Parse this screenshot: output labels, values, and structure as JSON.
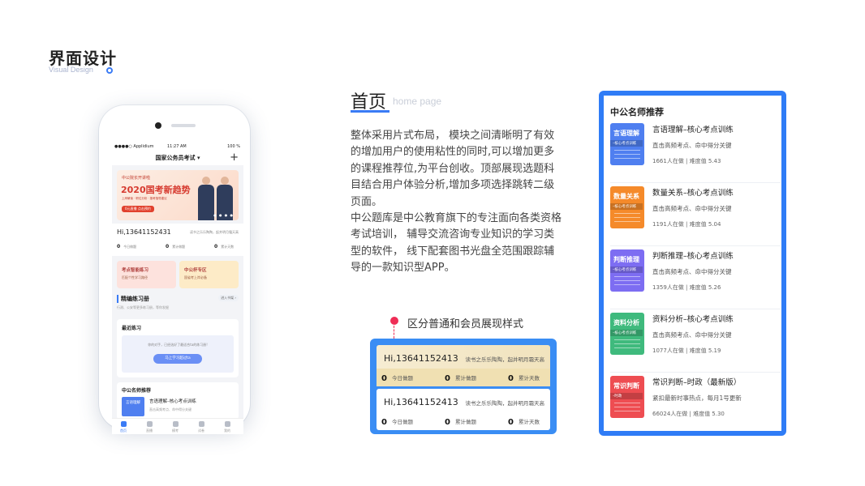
{
  "heading": {
    "title": "界面设计",
    "subtitle": "Visual Design"
  },
  "phone": {
    "status": {
      "carrier": "●●●●○ Applidium",
      "time": "11:27 AM",
      "battery": "100 %"
    },
    "nav_title": "国家公务员考试 ▾",
    "plus": "+",
    "banner": {
      "tag": "中公院长开讲啦",
      "main": "2020国考新趋势",
      "chips": "上岸解读 · 职位分析 · 报考指导建议",
      "button": "0元直播  点击预约"
    },
    "user": {
      "name": "Hi,13641152431",
      "note": "读书之乐乐陶陶，起并明月霜天高",
      "stats": [
        {
          "value": "0",
          "label": "今日做题"
        },
        {
          "value": "0",
          "label": "累计做题"
        },
        {
          "value": "0",
          "label": "累计天数"
        }
      ]
    },
    "cards": [
      {
        "title": "考点智能练习",
        "desc": "匹配个性学习路径",
        "color": "#fde2dd"
      },
      {
        "title": "中公杯专区",
        "desc": "国省考上岸必备",
        "color": "#fdebc7"
      }
    ],
    "section": {
      "title": "精编练习册",
      "desc": "行测、公安等更多练习册，等你发掘",
      "more": "进入书架 ›"
    },
    "recent": {
      "title": "最近练习",
      "desc": "你的对手，已经选好了最适合ta的练习册!",
      "button": "马上学习超过ta"
    },
    "teacher": {
      "title": "中公名师推荐",
      "thumb": "言语理解",
      "name": "言语理解–核心考点训练",
      "desc": "直击高频考点、命中得分关键"
    },
    "tabs": [
      {
        "label": "首页",
        "icon": "home-icon"
      },
      {
        "label": "直播",
        "icon": "live-icon"
      },
      {
        "label": "模考",
        "icon": "trophy-icon"
      },
      {
        "label": "试卷",
        "icon": "paper-icon"
      },
      {
        "label": "我的",
        "icon": "user-icon"
      }
    ]
  },
  "home": {
    "title": "首页",
    "subtitle": "home page",
    "para1": "整体采用片式布局， 模块之间清晰明了有效的增加用户的使用粘性的同时,可以增加更多的课程推荐位,为平台创收。顶部展现选题科目结合用户体验分析,增加多项选择跳转二级页面。",
    "para2": "中公题库是中公教育旗下的专注面向各类资格考试培训， 辅导交流咨询专业知识的学习类型的软件， 线下配套图书光盘全范围跟踪辅导的一款知识型APP。"
  },
  "member": {
    "label": "区分普通和会员展现样式",
    "cards": [
      {
        "name": "Hi,13641152413",
        "note": "读书之乐乐陶陶，起并明月霜天高",
        "stats": [
          {
            "value": "0",
            "label": "今日做题"
          },
          {
            "value": "0",
            "label": "累计做题"
          },
          {
            "value": "0",
            "label": "累计天数"
          }
        ]
      },
      {
        "name": "Hi,13641152413",
        "note": "读书之乐乐陶陶，起并明月霜天高",
        "stats": [
          {
            "value": "0",
            "label": "今日做题"
          },
          {
            "value": "0",
            "label": "累计做题"
          },
          {
            "value": "0",
            "label": "累计天数"
          }
        ]
      }
    ]
  },
  "recommend": {
    "title": "中公名师推荐",
    "items": [
      {
        "thumb": "言语理解",
        "sub": "–核心考点训练",
        "color": "#4f7ff0",
        "name": "言语理解–核心考点训练",
        "desc": "直击高频考点、命中得分关键",
        "meta": "1661人在做 | 难度值 5.43"
      },
      {
        "thumb": "数量关系",
        "sub": "–核心考点训练",
        "color": "#f58a2a",
        "name": "数量关系–核心考点训练",
        "desc": "直击高频考点、命中得分关键",
        "meta": "1191人在做 | 难度值 5.04"
      },
      {
        "thumb": "判断推理",
        "sub": "–核心考点训练",
        "color": "#7d6df2",
        "name": "判断推理–核心考点训练",
        "desc": "直击高频考点、命中得分关键",
        "meta": "1359人在做 | 难度值 5.26"
      },
      {
        "thumb": "资料分析",
        "sub": "–核心考点训练",
        "color": "#3fba7d",
        "name": "资料分析–核心考点训练",
        "desc": "直击高频考点、命中得分关键",
        "meta": "1077人在做 | 难度值 5.19"
      },
      {
        "thumb": "常识判断",
        "sub": "–时政",
        "color": "#ee4d52",
        "name": "常识判断–时政（最新版）",
        "desc": "紧扣最新时事热点，每月1号更新",
        "meta": "66024人在做 | 难度值 5.30"
      }
    ]
  }
}
